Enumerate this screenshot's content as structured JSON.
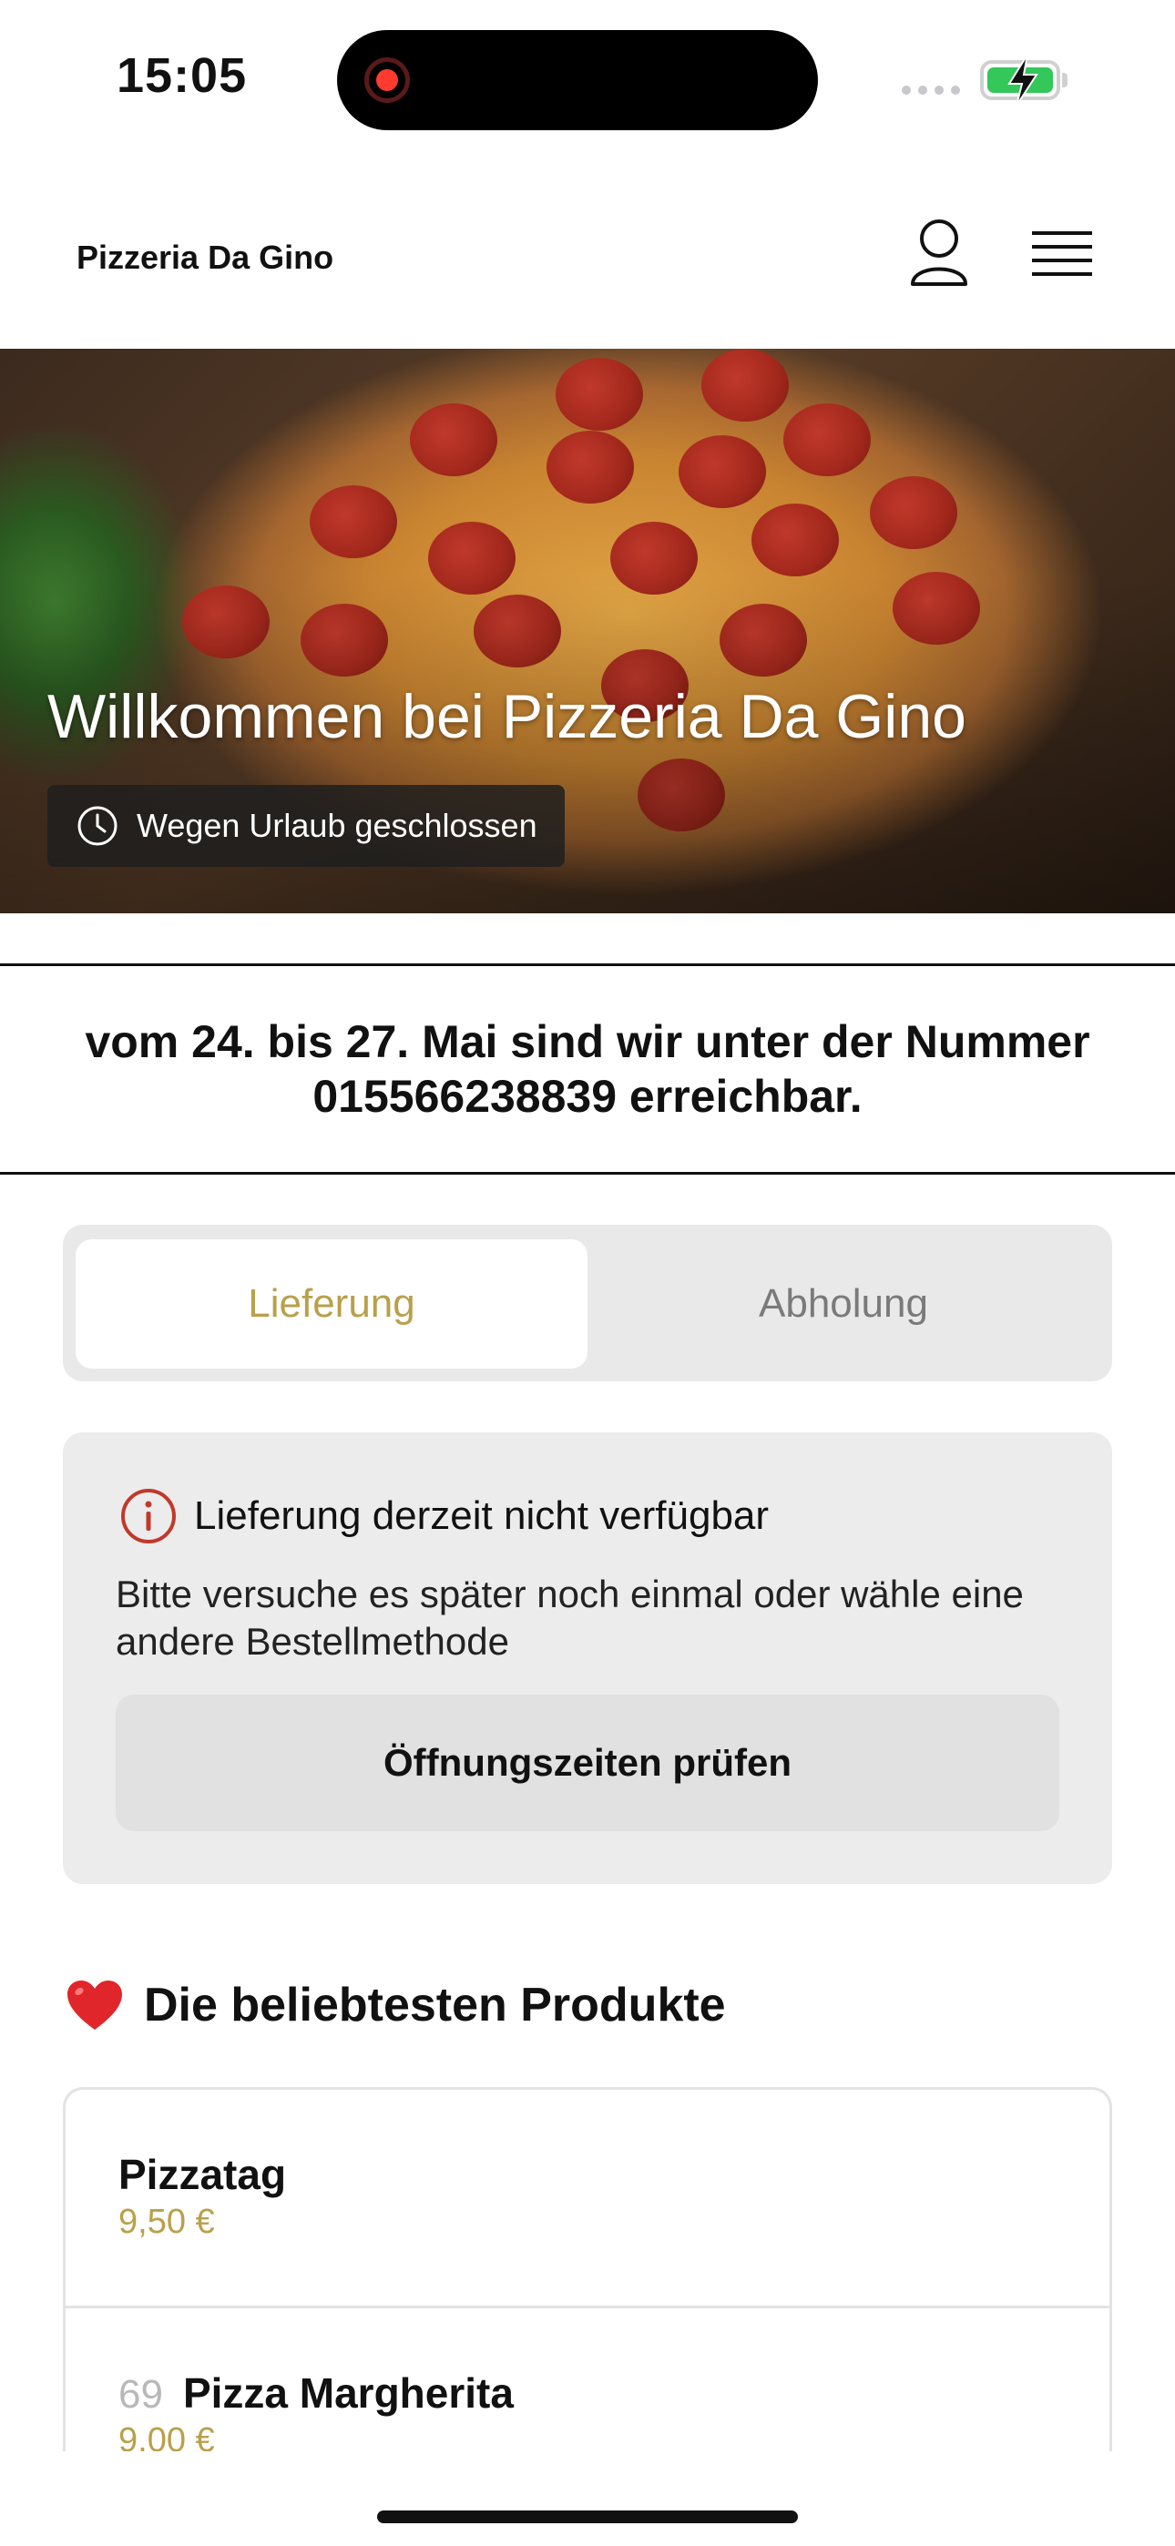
{
  "status_bar": {
    "time": "15:05"
  },
  "header": {
    "brand": "Pizzeria Da Gino",
    "icons": [
      "user-icon",
      "menu-icon"
    ]
  },
  "hero": {
    "title": "Willkommen bei Pizzeria Da Gino",
    "badge": "Wegen Urlaub geschlossen",
    "badge_icon": "clock-icon"
  },
  "notice": {
    "text": "vom 24. bis 27. Mai  sind wir unter der Nummer 015566238839 erreichbar."
  },
  "order_mode": {
    "options": [
      "Lieferung",
      "Abholung"
    ],
    "selected": "Lieferung"
  },
  "unavailable": {
    "icon": "info-icon",
    "title": "Lieferung derzeit nicht verfügbar",
    "body": "Bitte versuche es später noch einmal oder wähle eine andere Bestellmethode",
    "button": "Öffnungszeiten prüfen"
  },
  "popular": {
    "icon": "heart-icon",
    "title": "Die beliebtesten Produkte",
    "products": [
      {
        "number": "",
        "name": "Pizzatag",
        "price": "9,50 €"
      },
      {
        "number": "69",
        "name": "Pizza Margherita",
        "price": "9,00 €"
      }
    ]
  },
  "colors": {
    "accent": "#b9a04a",
    "alert_red": "#c0392b",
    "card_bg": "#ececec"
  }
}
